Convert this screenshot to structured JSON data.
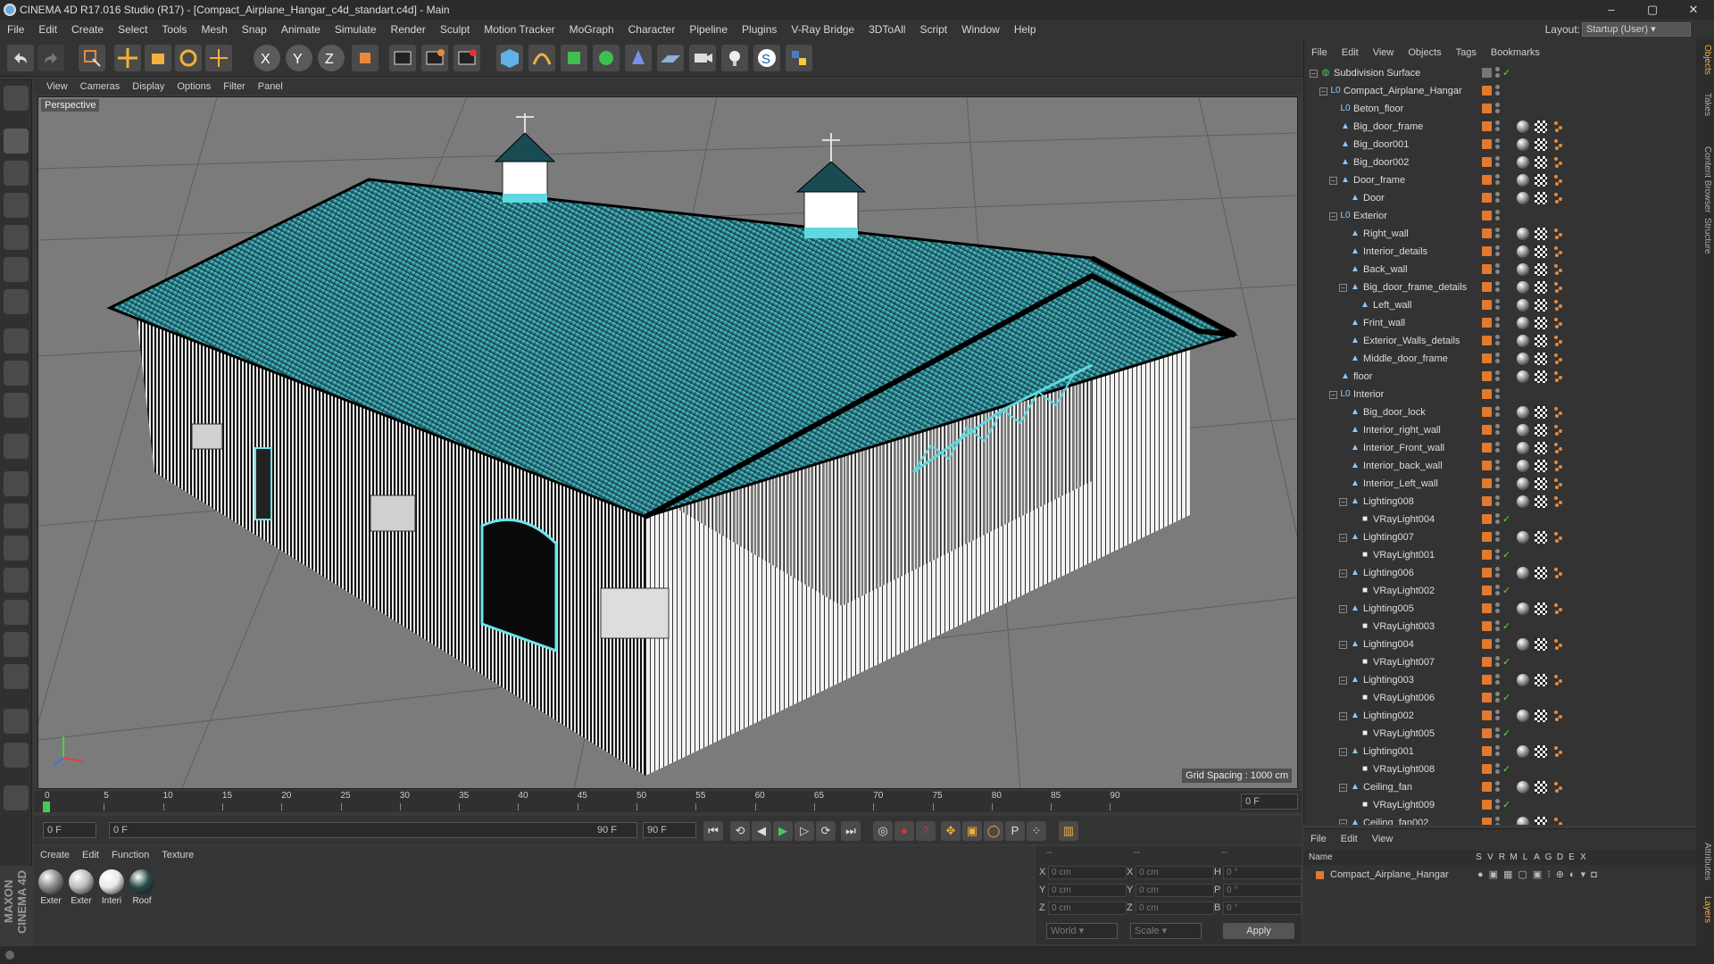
{
  "window": {
    "title": "CINEMA 4D R17.016 Studio (R17) - [Compact_Airplane_Hangar_c4d_standart.c4d] - Main",
    "min": "–",
    "max": "▢",
    "close": "✕"
  },
  "menu": [
    "File",
    "Edit",
    "Create",
    "Select",
    "Tools",
    "Mesh",
    "Snap",
    "Animate",
    "Simulate",
    "Render",
    "Sculpt",
    "Motion Tracker",
    "MoGraph",
    "Character",
    "Pipeline",
    "Plugins",
    "V-Ray Bridge",
    "3DToAll",
    "Script",
    "Window",
    "Help"
  ],
  "layout": {
    "label": "Layout:",
    "value": "Startup (User)"
  },
  "viewport": {
    "menu": [
      "View",
      "Cameras",
      "Display",
      "Options",
      "Filter",
      "Panel"
    ],
    "label": "Perspective",
    "grid_spacing": "Grid Spacing : 1000 cm"
  },
  "timeline": {
    "ticks": [
      "0",
      "5",
      "10",
      "15",
      "20",
      "25",
      "30",
      "35",
      "40",
      "45",
      "50",
      "55",
      "60",
      "65",
      "70",
      "75",
      "80",
      "85",
      "90"
    ],
    "end_frame": "0 F"
  },
  "transport": {
    "current": "0 F",
    "start": "0 F",
    "end": "90 F",
    "end2": "90 F"
  },
  "materials": {
    "menu": [
      "Create",
      "Edit",
      "Function",
      "Texture"
    ],
    "items": [
      {
        "label": "Exter",
        "color": "#8a8a8a"
      },
      {
        "label": "Exter",
        "color": "#bcbcbc"
      },
      {
        "label": "Interi",
        "color": "#e8e8e8"
      },
      {
        "label": "Roof",
        "color": "#2a4a4a"
      }
    ]
  },
  "coords": {
    "headers": [
      "--",
      "--",
      "--"
    ],
    "rows": [
      {
        "a": "X",
        "v1": "0 cm",
        "b": "X",
        "v2": "0 cm",
        "c": "H",
        "v3": "0 °"
      },
      {
        "a": "Y",
        "v1": "0 cm",
        "b": "Y",
        "v2": "0 cm",
        "c": "P",
        "v3": "0 °"
      },
      {
        "a": "Z",
        "v1": "0 cm",
        "b": "Z",
        "v2": "0 cm",
        "c": "B",
        "v3": "0 °"
      }
    ],
    "world": "World",
    "scale": "Scale",
    "apply": "Apply"
  },
  "objects": {
    "menu": [
      "File",
      "Edit",
      "View",
      "Objects",
      "Tags",
      "Bookmarks"
    ],
    "rows": [
      {
        "name": "Subdivision Surface",
        "depth": 0,
        "exp": "–",
        "icon": "◍",
        "tags": 0,
        "check": true,
        "vis": "#777"
      },
      {
        "name": "Compact_Airplane_Hangar",
        "depth": 1,
        "exp": "–",
        "icon": "L0",
        "tags": 0
      },
      {
        "name": "Beton_floor",
        "depth": 2,
        "icon": "L0",
        "tags": 0
      },
      {
        "name": "Big_door_frame",
        "depth": 2,
        "icon": "▲",
        "tags": 3
      },
      {
        "name": "Big_door001",
        "depth": 2,
        "icon": "▲",
        "tags": 3
      },
      {
        "name": "Big_door002",
        "depth": 2,
        "icon": "▲",
        "tags": 3
      },
      {
        "name": "Door_frame",
        "depth": 2,
        "exp": "–",
        "icon": "▲",
        "tags": 3
      },
      {
        "name": "Door",
        "depth": 3,
        "icon": "▲",
        "tags": 3
      },
      {
        "name": "Exterior",
        "depth": 2,
        "exp": "–",
        "icon": "L0",
        "tags": 0
      },
      {
        "name": "Right_wall",
        "depth": 3,
        "icon": "▲",
        "tags": 3
      },
      {
        "name": "Interior_details",
        "depth": 3,
        "icon": "▲",
        "tags": 3
      },
      {
        "name": "Back_wall",
        "depth": 3,
        "icon": "▲",
        "tags": 3
      },
      {
        "name": "Big_door_frame_details",
        "depth": 3,
        "exp": "–",
        "icon": "▲",
        "tags": 3
      },
      {
        "name": "Left_wall",
        "depth": 4,
        "icon": "▲",
        "tags": 3
      },
      {
        "name": "Frint_wall",
        "depth": 3,
        "icon": "▲",
        "tags": 3
      },
      {
        "name": "Exterior_Walls_details",
        "depth": 3,
        "icon": "▲",
        "tags": 3
      },
      {
        "name": "Middle_door_frame",
        "depth": 3,
        "icon": "▲",
        "tags": 3
      },
      {
        "name": "floor",
        "depth": 2,
        "icon": "▲",
        "tags": 3
      },
      {
        "name": "Interior",
        "depth": 2,
        "exp": "–",
        "icon": "L0",
        "tags": 0
      },
      {
        "name": "Big_door_lock",
        "depth": 3,
        "icon": "▲",
        "tags": 3
      },
      {
        "name": "Interior_right_wall",
        "depth": 3,
        "icon": "▲",
        "tags": 3
      },
      {
        "name": "Interior_Front_wall",
        "depth": 3,
        "icon": "▲",
        "tags": 3
      },
      {
        "name": "Interior_back_wall",
        "depth": 3,
        "icon": "▲",
        "tags": 3
      },
      {
        "name": "Interior_Left_wall",
        "depth": 3,
        "icon": "▲",
        "tags": 3
      },
      {
        "name": "Lighting008",
        "depth": 3,
        "exp": "–",
        "icon": "▲",
        "tags": 3
      },
      {
        "name": "VRayLight004",
        "depth": 4,
        "icon": "■",
        "tags": 0,
        "check": true
      },
      {
        "name": "Lighting007",
        "depth": 3,
        "exp": "–",
        "icon": "▲",
        "tags": 3
      },
      {
        "name": "VRayLight001",
        "depth": 4,
        "icon": "■",
        "tags": 0,
        "check": true
      },
      {
        "name": "Lighting006",
        "depth": 3,
        "exp": "–",
        "icon": "▲",
        "tags": 3
      },
      {
        "name": "VRayLight002",
        "depth": 4,
        "icon": "■",
        "tags": 0,
        "check": true
      },
      {
        "name": "Lighting005",
        "depth": 3,
        "exp": "–",
        "icon": "▲",
        "tags": 3
      },
      {
        "name": "VRayLight003",
        "depth": 4,
        "icon": "■",
        "tags": 0,
        "check": true
      },
      {
        "name": "Lighting004",
        "depth": 3,
        "exp": "–",
        "icon": "▲",
        "tags": 3
      },
      {
        "name": "VRayLight007",
        "depth": 4,
        "icon": "■",
        "tags": 0,
        "check": true
      },
      {
        "name": "Lighting003",
        "depth": 3,
        "exp": "–",
        "icon": "▲",
        "tags": 3
      },
      {
        "name": "VRayLight006",
        "depth": 4,
        "icon": "■",
        "tags": 0,
        "check": true
      },
      {
        "name": "Lighting002",
        "depth": 3,
        "exp": "–",
        "icon": "▲",
        "tags": 3
      },
      {
        "name": "VRayLight005",
        "depth": 4,
        "icon": "■",
        "tags": 0,
        "check": true
      },
      {
        "name": "Lighting001",
        "depth": 3,
        "exp": "–",
        "icon": "▲",
        "tags": 3
      },
      {
        "name": "VRayLight008",
        "depth": 4,
        "icon": "■",
        "tags": 0,
        "check": true
      },
      {
        "name": "Ceiling_fan",
        "depth": 3,
        "exp": "–",
        "icon": "▲",
        "tags": 3
      },
      {
        "name": "VRayLight009",
        "depth": 4,
        "icon": "■",
        "tags": 0,
        "check": true
      },
      {
        "name": "Ceiling_fan002",
        "depth": 3,
        "exp": "–",
        "icon": "▲",
        "tags": 3
      }
    ]
  },
  "layers": {
    "menu": [
      "File",
      "Edit",
      "View"
    ],
    "cols": {
      "name": "Name",
      "flags": [
        "S",
        "V",
        "R",
        "M",
        "L",
        "A",
        "G",
        "D",
        "E",
        "X"
      ]
    },
    "item": "Compact_Airplane_Hangar"
  },
  "right_tabs": [
    "Objects",
    "Takes",
    "Content Browser",
    "Structure",
    "Attributes",
    "Layers"
  ],
  "brand": "MAXON CINEMA 4D"
}
